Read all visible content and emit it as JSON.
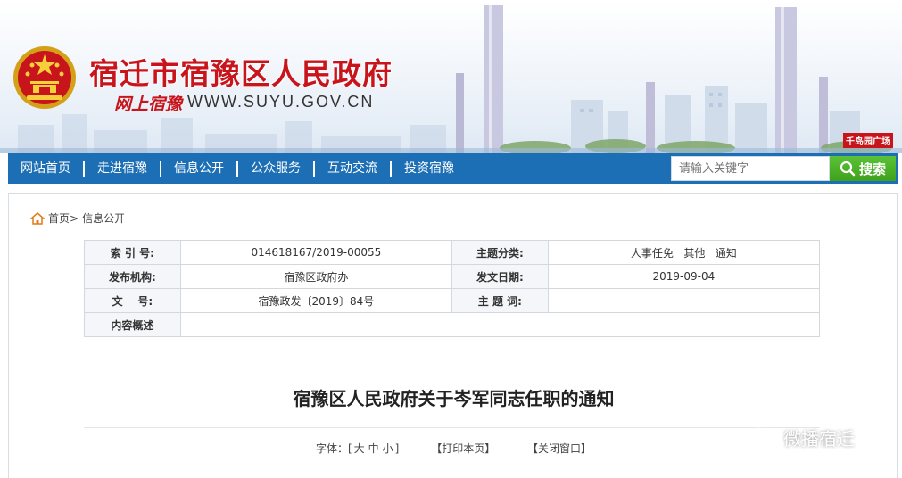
{
  "header": {
    "site_title": "宿迁市宿豫区人民政府",
    "slogan": "网上宿豫",
    "domain": "WWW.SUYU.GOV.CN",
    "park_tag": "千岛园广场",
    "emblem_icon": "national-emblem-icon"
  },
  "nav": {
    "items": [
      "网站首页",
      "走进宿豫",
      "信息公开",
      "公众服务",
      "互动交流",
      "投资宿豫"
    ],
    "search_placeholder": "请输入关键字",
    "search_label": "搜索"
  },
  "breadcrumb": {
    "home": "首页>",
    "current": "信息公开"
  },
  "meta_table": {
    "rows": [
      {
        "l1": "索 引 号:",
        "v1": "014618167/2019-00055",
        "l2": "主题分类:",
        "v2": "人事任免   其他   通知"
      },
      {
        "l1": "发布机构:",
        "v1": "宿豫区政府办",
        "l2": "发文日期:",
        "v2": "2019-09-04"
      },
      {
        "l1": "文    号:",
        "v1": "宿豫政发〔2019〕84号",
        "l2": "主 题 词:",
        "v2": ""
      },
      {
        "l1": "内容概述",
        "v1": ""
      }
    ]
  },
  "article": {
    "title": "宿豫区人民政府关于岑军同志任职的通知",
    "font_label": "字体：[",
    "font_large": "大",
    "font_medium": "中",
    "font_small": "小",
    "font_close": "]",
    "print": "【打印本页】",
    "close": "【关闭窗口】"
  },
  "watermark": {
    "text": "微播宿迁"
  },
  "colors": {
    "brand_red": "#c8141b",
    "nav_blue": "#1c6fb5",
    "search_green": "#3fa11d"
  }
}
